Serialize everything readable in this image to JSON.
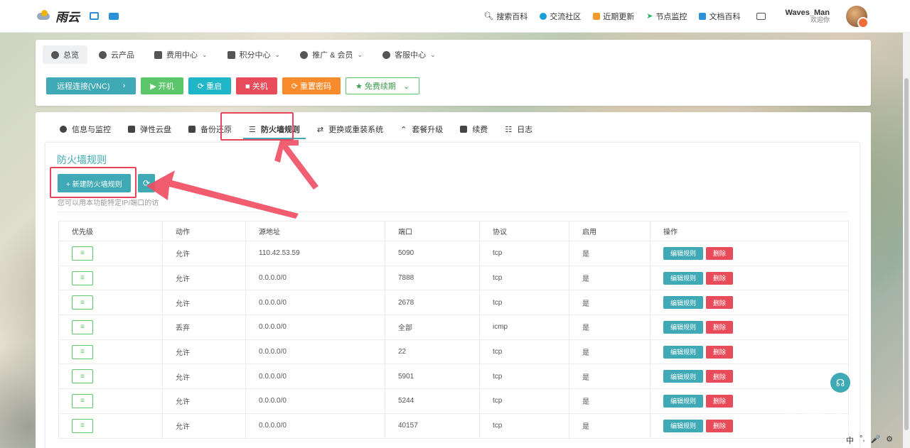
{
  "brand": {
    "name": "雨云"
  },
  "topnav": {
    "items": [
      {
        "label": "搜索百科",
        "icon": "search-icon",
        "color": "#333333"
      },
      {
        "label": "交流社区",
        "icon": "community-icon",
        "color": "#1a9fd8"
      },
      {
        "label": "近期更新",
        "icon": "update-icon",
        "color": "#f29a2c"
      },
      {
        "label": "节点监控",
        "icon": "monitor-icon",
        "color": "#2fb36b"
      },
      {
        "label": "文档百科",
        "icon": "book-icon",
        "color": "#2a90d8"
      }
    ],
    "user": {
      "name": "Waves_Man",
      "welcome": "欢迎你"
    }
  },
  "menu": {
    "items": [
      {
        "label": "总览",
        "caret": false
      },
      {
        "label": "云产品",
        "caret": false
      },
      {
        "label": "费用中心",
        "caret": true
      },
      {
        "label": "积分中心",
        "caret": true
      },
      {
        "label": "推广 & 会员",
        "caret": true
      },
      {
        "label": "客服中心",
        "caret": true
      }
    ]
  },
  "actions": {
    "vnc": "远程连接(VNC)",
    "vnc_arrow": "›",
    "power_on": "▶ 开机",
    "restart": "⟳ 重启",
    "shutdown": "■ 关机",
    "reset_pwd": "⟳ 重置密码",
    "renew": "★ 免费续期",
    "renew_caret": "⌄"
  },
  "tabs": [
    {
      "label": "信息与监控",
      "icon": "info-icon"
    },
    {
      "label": "弹性云盘",
      "icon": "disk-icon"
    },
    {
      "label": "备份还原",
      "icon": "backup-icon"
    },
    {
      "label": "防火墙规则",
      "icon": "firewall-icon",
      "active": true
    },
    {
      "label": "更换或重装系统",
      "icon": "swap-icon"
    },
    {
      "label": "套餐升级",
      "icon": "upgrade-icon"
    },
    {
      "label": "续费",
      "icon": "renew-icon"
    },
    {
      "label": "日志",
      "icon": "log-icon"
    }
  ],
  "firewall": {
    "title": "防火墙规则",
    "new_button": "+ 新建防火墙规则",
    "refresh_icon": "⟳",
    "hint": "您可以用本功能特定IP/端口的访",
    "columns": [
      "优先级",
      "动作",
      "源地址",
      "端口",
      "协议",
      "启用",
      "操作"
    ],
    "edit_label": "编辑规则",
    "delete_label": "删除",
    "priority_glyph": "≡",
    "rows": [
      {
        "action": "允许",
        "source": "110.42.53.59",
        "port": "5090",
        "protocol": "tcp",
        "enabled": "是"
      },
      {
        "action": "允许",
        "source": "0.0.0.0/0",
        "port": "7888",
        "protocol": "tcp",
        "enabled": "是"
      },
      {
        "action": "允许",
        "source": "0.0.0.0/0",
        "port": "2678",
        "protocol": "tcp",
        "enabled": "是"
      },
      {
        "action": "丢弃",
        "source": "0.0.0.0/0",
        "port": "全部",
        "protocol": "icmp",
        "enabled": "是"
      },
      {
        "action": "允许",
        "source": "0.0.0.0/0",
        "port": "22",
        "protocol": "tcp",
        "enabled": "是"
      },
      {
        "action": "允许",
        "source": "0.0.0.0/0",
        "port": "5901",
        "protocol": "tcp",
        "enabled": "是"
      },
      {
        "action": "允许",
        "source": "0.0.0.0/0",
        "port": "5244",
        "protocol": "tcp",
        "enabled": "是"
      },
      {
        "action": "允许",
        "source": "0.0.0.0/0",
        "port": "40157",
        "protocol": "tcp",
        "enabled": "是"
      }
    ]
  },
  "watermark": "小黑盒",
  "taskbar": [
    "中",
    "°,",
    "🎤",
    "⚙"
  ],
  "colors": {
    "accent": "#3fa9b5",
    "success": "#5cc66b",
    "danger": "#e84c5a",
    "warning": "#f98b2c",
    "annotation": "#e8455a"
  }
}
